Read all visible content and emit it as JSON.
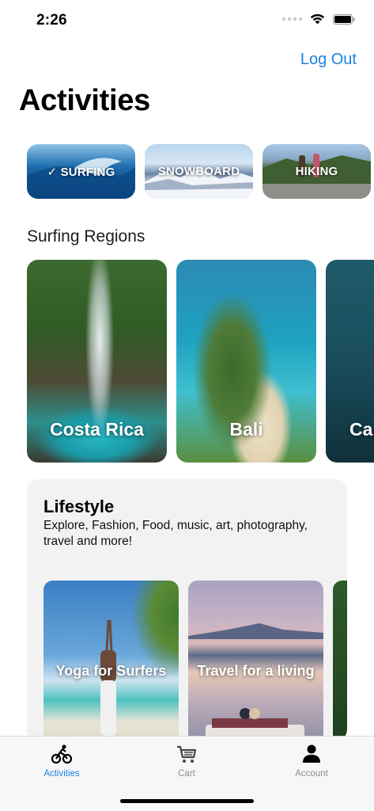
{
  "status_bar": {
    "time": "2:26"
  },
  "header": {
    "logout_label": "Log Out",
    "title": "Activities"
  },
  "activity_chips": [
    {
      "label": "✓ SURFING",
      "selected": true
    },
    {
      "label": "SNOWBOARD",
      "selected": false
    },
    {
      "label": "HIKING",
      "selected": false
    }
  ],
  "regions": {
    "heading": "Surfing Regions",
    "items": [
      {
        "label": "Costa Rica"
      },
      {
        "label": "Bali"
      },
      {
        "label": "Cap"
      }
    ]
  },
  "lifestyle": {
    "title": "Lifestyle",
    "description": "Explore, Fashion, Food, music, art, photography, travel and more!",
    "items": [
      {
        "label": "Yoga for Surfers"
      },
      {
        "label": "Travel for a living"
      }
    ]
  },
  "tab_bar": {
    "active_color": "#1a82e2",
    "inactive_color": "#8e8e93",
    "tabs": [
      {
        "label": "Activities",
        "icon": "cyclist-icon",
        "active": true
      },
      {
        "label": "Cart",
        "icon": "cart-icon",
        "active": false
      },
      {
        "label": "Account",
        "icon": "person-icon",
        "active": false
      }
    ]
  }
}
